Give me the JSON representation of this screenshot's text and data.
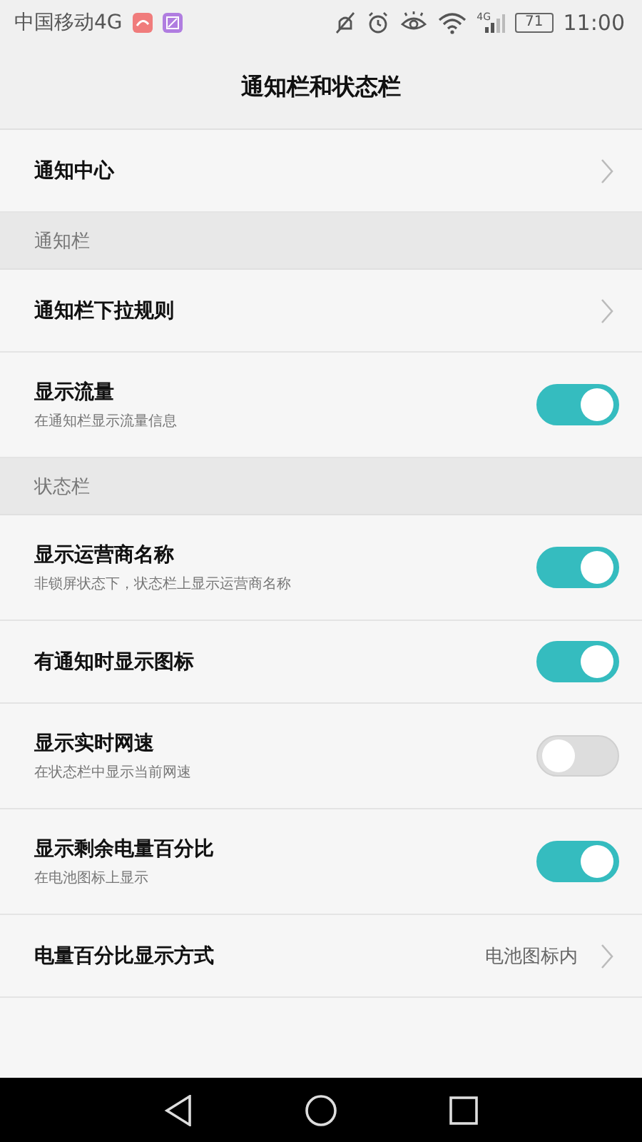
{
  "status_bar": {
    "carrier": "中国移动4G",
    "network": "4G",
    "battery": "71",
    "time": "11:00"
  },
  "title": "通知栏和状态栏",
  "items": [
    {
      "kind": "link",
      "label": "通知中心"
    },
    {
      "kind": "header",
      "label": "通知栏"
    },
    {
      "kind": "link",
      "label": "通知栏下拉规则"
    },
    {
      "kind": "toggle",
      "label": "显示流量",
      "description": "在通知栏显示流量信息",
      "on": true
    },
    {
      "kind": "header",
      "label": "状态栏"
    },
    {
      "kind": "toggle",
      "label": "显示运营商名称",
      "description": "非锁屏状态下，状态栏上显示运营商名称",
      "on": true
    },
    {
      "kind": "toggle",
      "label": "有通知时显示图标",
      "on": true
    },
    {
      "kind": "toggle",
      "label": "显示实时网速",
      "description": "在状态栏中显示当前网速",
      "on": false
    },
    {
      "kind": "toggle",
      "label": "显示剩余电量百分比",
      "description": "在电池图标上显示",
      "on": true
    },
    {
      "kind": "link",
      "label": "电量百分比显示方式",
      "value": "电池图标内"
    }
  ]
}
